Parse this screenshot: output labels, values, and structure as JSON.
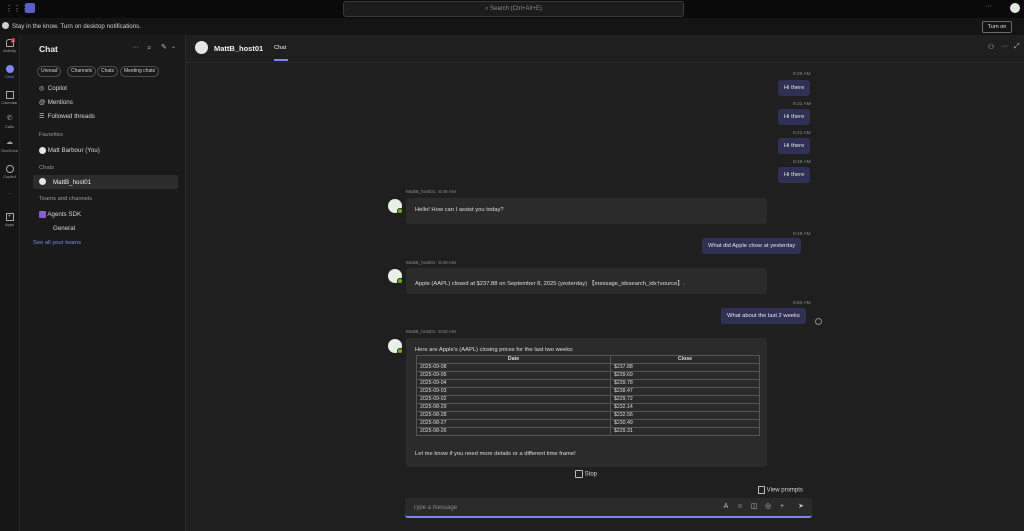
{
  "titlebar": {
    "search_placeholder": "Search (Ctrl+Alt+E)"
  },
  "notification": {
    "text": "Stay in the know. Turn on desktop notifications.",
    "button": "Turn on"
  },
  "rail": [
    {
      "label": "Activity",
      "icon": "bell-icon",
      "badge": "1"
    },
    {
      "label": "Chat",
      "icon": "chat-icon"
    },
    {
      "label": "Calendar",
      "icon": "calendar-icon"
    },
    {
      "label": "Calls",
      "icon": "phone-icon"
    },
    {
      "label": "OneDrive",
      "icon": "cloud-icon"
    },
    {
      "label": "Copilot",
      "icon": "copilot-icon"
    },
    {
      "label": "Apps",
      "icon": "apps-icon"
    }
  ],
  "chatlist": {
    "title": "Chat",
    "filters": [
      "Unread",
      "Channels",
      "Chats",
      "Meeting chats"
    ],
    "nav": [
      "Copilot",
      "Mentions",
      "Followed threads"
    ],
    "favorites_label": "Favorites",
    "favorites": [
      "Matt Barbour (You)"
    ],
    "chats_label": "Chats",
    "chats": [
      "MattB_host01"
    ],
    "teams_label": "Teams and channels",
    "team": "Agents SDK",
    "channel": "General",
    "see_all": "See all your teams"
  },
  "header": {
    "name": "MattB_host01",
    "tab": "Chat"
  },
  "messages": {
    "r1": {
      "time": "8:25 AM",
      "text": "Hi there"
    },
    "r2": {
      "time": "8:31 AM",
      "text": "Hi there"
    },
    "r3": {
      "time": "8:41 AM",
      "text": "Hi there"
    },
    "r4": {
      "time": "8:48 AM",
      "text": "Hi there"
    },
    "b1": {
      "author": "MattB_host01",
      "time": "8:48 AM",
      "text": "Hello! How can I assist you today?"
    },
    "r5": {
      "time": "8:49 AM",
      "text": "What did Apple close at yesterday"
    },
    "b2": {
      "author": "MattB_host01",
      "time": "8:49 AM",
      "text": "Apple (AAPL) closed at $237.88 on September 8, 2025 (yesterday) 【message_idxsearch_idx†source】."
    },
    "r6": {
      "time": "8:50 AM",
      "text": "What about the last 2 weeks"
    },
    "b3": {
      "author": "MattB_host01",
      "time": "8:50 AM",
      "intro": "Here are Apple's (AAPL) closing prices for the last two weeks:",
      "outro": "Let me know if you need more details or a different time frame!",
      "col_date": "Date",
      "col_close": "Close"
    }
  },
  "table_rows": [
    [
      "2025-09-08",
      "$237.88"
    ],
    [
      "2025-09-05",
      "$239.69"
    ],
    [
      "2025-09-04",
      "$239.78"
    ],
    [
      "2025-09-03",
      "$238.47"
    ],
    [
      "2025-09-02",
      "$229.72"
    ],
    [
      "2025-08-29",
      "$232.14"
    ],
    [
      "2025-08-28",
      "$232.56"
    ],
    [
      "2025-08-27",
      "$230.49"
    ],
    [
      "2025-08-26",
      "$229.31"
    ]
  ],
  "controls": {
    "stop": "Stop",
    "view_prompts": "View prompts",
    "composer_placeholder": "Type a message"
  },
  "colors": {
    "accent": "#7f85f5",
    "bubble_self": "#2f3054",
    "bubble_bot": "#2b2b2b",
    "presence": "#6bb700"
  }
}
